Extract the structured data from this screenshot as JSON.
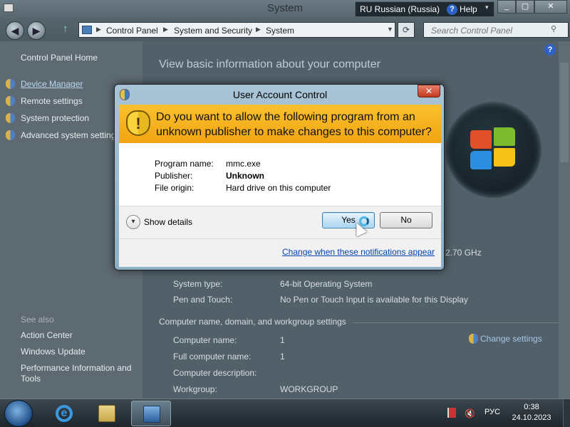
{
  "window": {
    "title": "System",
    "language_bar": {
      "lang": "RU Russian (Russia)",
      "help": "Help"
    },
    "caption_buttons": {
      "minimize": "_",
      "maximize": "▢",
      "close": "✕"
    }
  },
  "address_bar": {
    "crumbs": [
      "Control Panel",
      "System and Security",
      "System"
    ],
    "search_placeholder": "Search Control Panel"
  },
  "sidebar": {
    "home": "Control Panel Home",
    "items": [
      {
        "label": "Device Manager"
      },
      {
        "label": "Remote settings"
      },
      {
        "label": "System protection"
      },
      {
        "label": "Advanced system settings"
      }
    ],
    "see_also_title": "See also",
    "see_also": [
      "Action Center",
      "Windows Update",
      "Performance Information and",
      "Tools"
    ]
  },
  "main": {
    "heading": "View basic information about your computer",
    "processor_speed": "2.70 GHz",
    "system_rows": [
      {
        "label": "System type:",
        "value": "64-bit Operating System"
      },
      {
        "label": "Pen and Touch:",
        "value": "No Pen or Touch Input is available for this Display"
      }
    ],
    "section_title": "Computer name, domain, and workgroup settings",
    "change_settings": "Change settings",
    "name_rows": [
      {
        "label": "Computer name:",
        "value": "1"
      },
      {
        "label": "Full computer name:",
        "value": "1"
      },
      {
        "label": "Computer description:",
        "value": ""
      },
      {
        "label": "Workgroup:",
        "value": "WORKGROUP"
      }
    ]
  },
  "uac": {
    "title": "User Account Control",
    "question": "Do you want to allow the following program from an unknown publisher to make changes to this computer?",
    "fields": [
      {
        "key": "Program name:",
        "value": "mmc.exe"
      },
      {
        "key": "Publisher:",
        "value": "Unknown"
      },
      {
        "key": "File origin:",
        "value": "Hard drive on this computer"
      }
    ],
    "show_details": "Show details",
    "yes": "Yes",
    "no": "No",
    "notif_link": "Change when these notifications appear",
    "banner_color": "#f5b01e"
  },
  "taskbar": {
    "lang": "РУС",
    "time": "0:38",
    "date": "24.10.2023"
  }
}
